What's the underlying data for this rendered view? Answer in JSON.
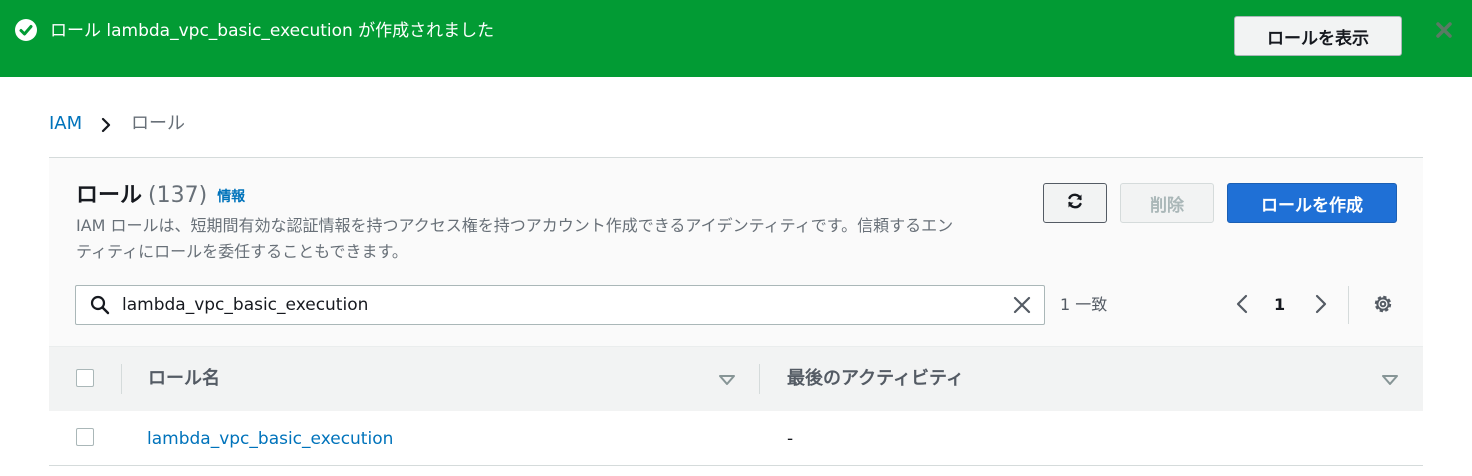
{
  "banner": {
    "message": "ロール lambda_vpc_basic_execution が作成されました",
    "view_button": "ロールを表示",
    "color": "#029b34"
  },
  "breadcrumb": {
    "root": "IAM",
    "current": "ロール"
  },
  "header": {
    "title": "ロール",
    "count": "(137)",
    "info_link": "情報",
    "description": "IAM ロールは、短期間有効な認証情報を持つアクセス権を持つアカウント作成できるアイデンティティです。信頼するエンティティにロールを委任することもできます。"
  },
  "actions": {
    "refresh_icon": "refresh-icon",
    "delete_label": "削除",
    "create_label": "ロールを作成",
    "primary_color": "#1f70d6"
  },
  "search": {
    "value": "lambda_vpc_basic_execution",
    "match_text": "1 一致"
  },
  "pagination": {
    "page": "1"
  },
  "table": {
    "columns": [
      "ロール名",
      "最後のアクティビティ"
    ],
    "rows": [
      {
        "role_name": "lambda_vpc_basic_execution",
        "last_activity": "-"
      }
    ]
  }
}
